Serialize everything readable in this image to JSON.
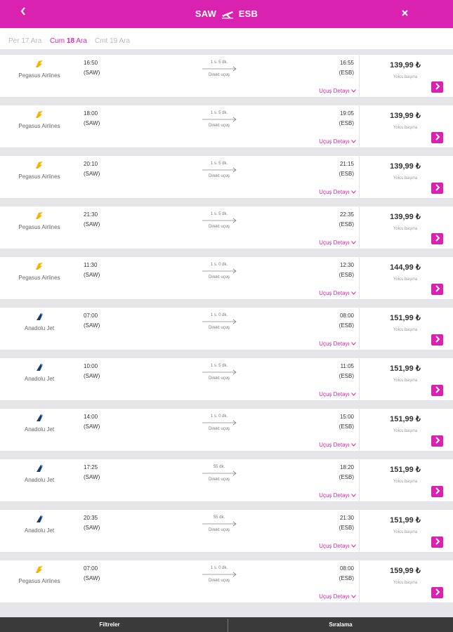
{
  "header": {
    "back_icon": "chevron-left-icon",
    "origin": "SAW",
    "destination": "ESB",
    "plane_icon": "plane-icon",
    "close_icon": "close-icon",
    "color": "#d923b0"
  },
  "dates": {
    "prev": "Per 17 Ara",
    "current_prefix": "Cum ",
    "current_day": "18",
    "current_suffix": " Ara",
    "next": "Cmt 19 Ara"
  },
  "flights": [
    {
      "airline": "Pegasus Airlines",
      "logo": "pegasus",
      "dep_time": "16:50",
      "dep_code": "(SAW)",
      "duration": "1 s. 5 dk.",
      "stops": "Direkt uçuş",
      "arr_time": "16:55",
      "arr_code": "(ESB)",
      "details": "Uçuş Detayı",
      "price": "139,99 ₺",
      "per_person": "Yolcu başına"
    },
    {
      "airline": "Pegasus Airlines",
      "logo": "pegasus",
      "dep_time": "18:00",
      "dep_code": "(SAW)",
      "duration": "1 s. 5 dk.",
      "stops": "Direkt uçuş",
      "arr_time": "19:05",
      "arr_code": "(ESB)",
      "details": "Uçuş Detayı",
      "price": "139,99 ₺",
      "per_person": "Yolcu başına"
    },
    {
      "airline": "Pegasus Airlines",
      "logo": "pegasus",
      "dep_time": "20:10",
      "dep_code": "(SAW)",
      "duration": "1 s. 5 dk.",
      "stops": "Direkt uçuş",
      "arr_time": "21:15",
      "arr_code": "(ESB)",
      "details": "Uçuş Detayı",
      "price": "139,99 ₺",
      "per_person": "Yolcu başına"
    },
    {
      "airline": "Pegasus Airlines",
      "logo": "pegasus",
      "dep_time": "21:30",
      "dep_code": "(SAW)",
      "duration": "1 s. 5 dk.",
      "stops": "Direkt uçuş",
      "arr_time": "22:35",
      "arr_code": "(ESB)",
      "details": "Uçuş Detayı",
      "price": "139,99 ₺",
      "per_person": "Yolcu başına"
    },
    {
      "airline": "Pegasus Airlines",
      "logo": "pegasus",
      "dep_time": "11:30",
      "dep_code": "(SAW)",
      "duration": "1 s. 0 dk.",
      "stops": "Direkt uçuş",
      "arr_time": "12:30",
      "arr_code": "(ESB)",
      "details": "Uçuş Detayı",
      "price": "144,99 ₺",
      "per_person": "Yolcu başına"
    },
    {
      "airline": "Anadolu Jet",
      "logo": "anadolujet",
      "dep_time": "07:00",
      "dep_code": "(SAW)",
      "duration": "1 s. 0 dk.",
      "stops": "Direkt uçuş",
      "arr_time": "08:00",
      "arr_code": "(ESB)",
      "details": "Uçuş Detayı",
      "price": "151,99 ₺",
      "per_person": "Yolcu başına"
    },
    {
      "airline": "Anadolu Jet",
      "logo": "anadolujet",
      "dep_time": "10:00",
      "dep_code": "(SAW)",
      "duration": "1 s. 5 dk.",
      "stops": "Direkt uçuş",
      "arr_time": "11:05",
      "arr_code": "(ESB)",
      "details": "Uçuş Detayı",
      "price": "151,99 ₺",
      "per_person": "Yolcu başına"
    },
    {
      "airline": "Anadolu Jet",
      "logo": "anadolujet",
      "dep_time": "14:00",
      "dep_code": "(SAW)",
      "duration": "1 s. 0 dk.",
      "stops": "Direkt uçuş",
      "arr_time": "15:00",
      "arr_code": "(ESB)",
      "details": "Uçuş Detayı",
      "price": "151,99 ₺",
      "per_person": "Yolcu başına"
    },
    {
      "airline": "Anadolu Jet",
      "logo": "anadolujet",
      "dep_time": "17:25",
      "dep_code": "(SAW)",
      "duration": "55 dk.",
      "stops": "Direkt uçuş",
      "arr_time": "18:20",
      "arr_code": "(ESB)",
      "details": "Uçuş Detayı",
      "price": "151,99 ₺",
      "per_person": "Yolcu başına"
    },
    {
      "airline": "Anadolu Jet",
      "logo": "anadolujet",
      "dep_time": "20:35",
      "dep_code": "(SAW)",
      "duration": "55 dk.",
      "stops": "Direkt uçuş",
      "arr_time": "21:30",
      "arr_code": "(ESB)",
      "details": "Uçuş Detayı",
      "price": "151,99 ₺",
      "per_person": "Yolcu başına"
    },
    {
      "airline": "Pegasus Airlines",
      "logo": "pegasus",
      "dep_time": "07:00",
      "dep_code": "(SAW)",
      "duration": "1 s. 0 dk.",
      "stops": "Direkt uçuş",
      "arr_time": "08:00",
      "arr_code": "(ESB)",
      "details": "Uçuş Detayı",
      "price": "159,99 ₺",
      "per_person": "Yolcu başına"
    }
  ],
  "bottom": {
    "filters": "Filtreler",
    "sort": "Sıralama"
  },
  "colors": {
    "accent": "#d923b0",
    "pegasus": "#f6b400",
    "anadolujet": "#1a3c73"
  }
}
